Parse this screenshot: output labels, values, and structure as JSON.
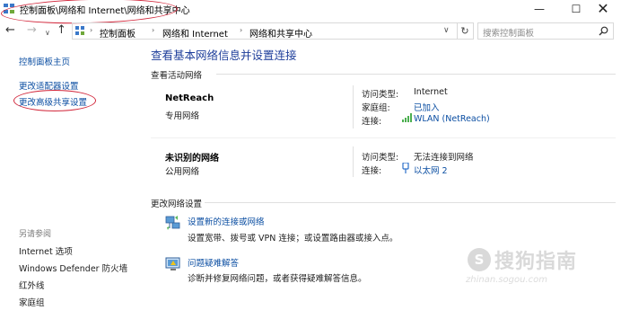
{
  "window": {
    "title": "控制面板\\网络和 Internet\\网络和共享中心",
    "minimize_glyph": "—",
    "maximize_glyph": "☐",
    "close_glyph": "✕"
  },
  "address_bar": {
    "back_glyph": "←",
    "forward_glyph": "→",
    "history_glyph": "∨",
    "up_glyph": "↑",
    "crumbs": [
      "控制面板",
      "网络和 Internet",
      "网络和共享中心"
    ],
    "separator": "›",
    "dropdown_glyph": "∨",
    "refresh_glyph": "↻",
    "search_placeholder": "搜索控制面板"
  },
  "sidebar": {
    "top_links": [
      "控制面板主页",
      "更改适配器设置",
      "更改高级共享设置"
    ],
    "see_also_heading": "另请参阅",
    "see_also_links": [
      "Internet 选项",
      "Windows Defender 防火墙",
      "红外线",
      "家庭组"
    ]
  },
  "main": {
    "title": "查看基本网络信息并设置连接",
    "active_networks_heading": "查看活动网络",
    "networks": [
      {
        "name": "NetReach",
        "type": "专用网络",
        "access_label": "访问类型:",
        "access_value": "Internet",
        "homegroup_label": "家庭组:",
        "homegroup_value": "已加入",
        "connection_label": "连接:",
        "connection_value": "WLAN (NetReach)",
        "connection_icon": "wifi-signal-icon"
      },
      {
        "name": "未识别的网络",
        "type": "公用网络",
        "access_label": "访问类型:",
        "access_value": "无法连接到网络",
        "connection_label": "连接:",
        "connection_value": "以太网 2",
        "connection_icon": "ethernet-icon"
      }
    ],
    "change_settings_heading": "更改网络设置",
    "tasks": [
      {
        "link": "设置新的连接或网络",
        "description": "设置宽带、拨号或 VPN 连接；或设置路由器或接入点。",
        "icon": "new-connection-icon"
      },
      {
        "link": "问题疑难解答",
        "description": "诊断并修复网络问题，或者获得疑难解答信息。",
        "icon": "troubleshoot-icon"
      }
    ]
  },
  "watermark": {
    "badge": "S",
    "text": "搜狗指南",
    "url": "zhinan.sogou.com"
  },
  "colors": {
    "link": "#0b4ea2",
    "title_blue": "#1f3f9b",
    "annotation_red": "#d2283c"
  }
}
